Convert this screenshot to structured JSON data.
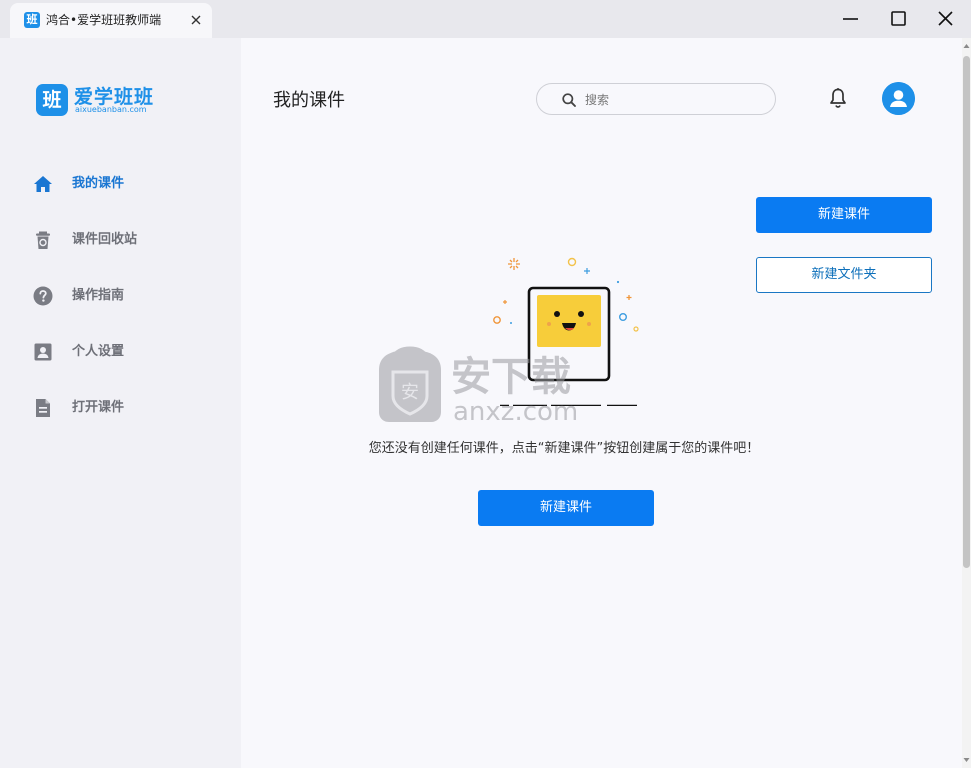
{
  "window": {
    "tab_title": "鸿合•爱学班班教师端",
    "tab_logo_char": "班"
  },
  "sidebar": {
    "brand_char": "班",
    "brand_name": "爱学班班",
    "brand_url": "aixuebanban.com",
    "items": [
      {
        "label": "我的课件",
        "icon": "home-icon",
        "active": true
      },
      {
        "label": "课件回收站",
        "icon": "recycle-bin-icon",
        "active": false
      },
      {
        "label": "操作指南",
        "icon": "help-icon",
        "active": false
      },
      {
        "label": "个人设置",
        "icon": "person-card-icon",
        "active": false
      },
      {
        "label": "打开课件",
        "icon": "document-icon",
        "active": false
      }
    ]
  },
  "header": {
    "title": "我的课件",
    "search_placeholder": "搜索"
  },
  "actions": {
    "new_courseware": "新建课件",
    "new_folder": "新建文件夹",
    "new_courseware_center": "新建课件"
  },
  "empty_state": {
    "message": "您还没有创建任何课件，点击“新建课件”按钮创建属于您的课件吧！"
  },
  "watermark": {
    "char": "安",
    "title": "安下载",
    "domain": "anxz.com"
  },
  "colors": {
    "accent": "#0a7bf2",
    "brand": "#1e90e8",
    "sidebar_bg": "#f1f1f6",
    "main_bg": "#f8f8fc",
    "illustration_face": "#f7cd3a"
  }
}
